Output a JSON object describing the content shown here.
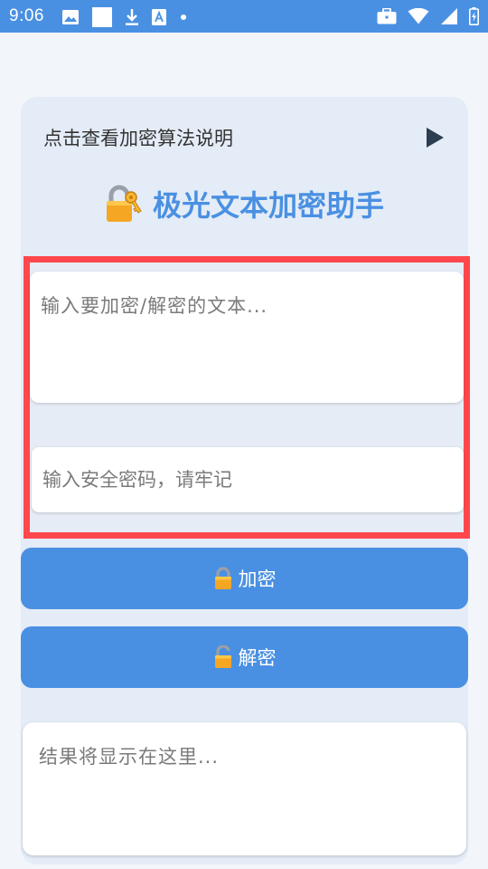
{
  "status_bar": {
    "time": "9:06",
    "left_icons": [
      "image-icon",
      "blank-square-icon",
      "download-icon",
      "font-a-icon",
      "dot-icon"
    ],
    "right_icons": [
      "briefcase-icon",
      "wifi-icon",
      "signal-icon",
      "battery-icon"
    ]
  },
  "guide": {
    "label": "点击查看加密算法说明",
    "icon": "play-icon"
  },
  "header": {
    "title": "极光文本加密助手",
    "icon": "lock-key-icon"
  },
  "inputs": {
    "text_placeholder": "输入要加密/解密的文本...",
    "text_value": "",
    "password_placeholder": "输入安全密码，请牢记",
    "password_value": ""
  },
  "buttons": {
    "encrypt_label": "加密",
    "encrypt_icon": "lock-icon",
    "decrypt_label": "解密",
    "decrypt_icon": "unlock-icon"
  },
  "result": {
    "placeholder": "结果将显示在这里..."
  },
  "colors": {
    "accent": "#4a90e2",
    "highlight": "#ff474c",
    "card": "#e4ecf7"
  }
}
